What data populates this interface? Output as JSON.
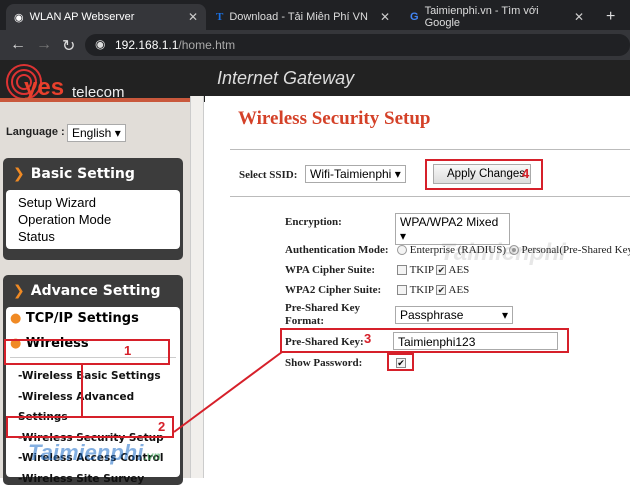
{
  "browser": {
    "tabs": [
      {
        "title": "WLAN AP Webserver",
        "active": true
      },
      {
        "title": "Download - Tải Miễn Phí VN - Ph"
      },
      {
        "title": "Taimienphi.vn - Tìm với Google"
      }
    ],
    "url_host": "192.168.1.1",
    "url_path": "/home.htm"
  },
  "header": {
    "logo_yes": "yes",
    "logo_telecom": "telecom",
    "title": "Internet Gateway"
  },
  "sidebar": {
    "language_label": "Language :",
    "language_value": "English",
    "basic": {
      "title": "Basic Setting",
      "items": [
        "Setup Wizard",
        "Operation Mode",
        "Status"
      ]
    },
    "advance": {
      "title": "Advance Setting",
      "tcpip": "TCP/IP Settings",
      "wireless": "Wireless",
      "sub": [
        "-Wireless Basic Settings",
        "-Wireless Advanced Settings",
        "-Wireless Security Setup",
        "-Wireless Access Control",
        "-Wireless Site Survey"
      ]
    }
  },
  "main": {
    "title": "Wireless Security Setup",
    "ssid_label": "Select SSID:",
    "ssid_value": "Wifi-Taimienphi",
    "apply": "Apply Changes",
    "encryption_label": "Encryption:",
    "encryption_value": "WPA/WPA2 Mixed",
    "auth_label": "Authentication Mode:",
    "auth_enterprise": "Enterprise (RADIUS)",
    "auth_personal": "Personal(Pre-Shared Key)",
    "wpa_label": "WPA Cipher Suite:",
    "wpa2_label": "WPA2 Cipher Suite:",
    "tkip": "TKIP",
    "aes": "AES",
    "psk_format_label": "Pre-Shared Key Format:",
    "psk_format_value": "Passphrase",
    "psk_label": "Pre-Shared Key:",
    "psk_value": "Taimienphi123",
    "show_pw_label": "Show Password:"
  },
  "annotations": [
    "1",
    "2",
    "3",
    "4"
  ],
  "watermark": {
    "text": "Taimienphi",
    "suffix": ".vn"
  }
}
